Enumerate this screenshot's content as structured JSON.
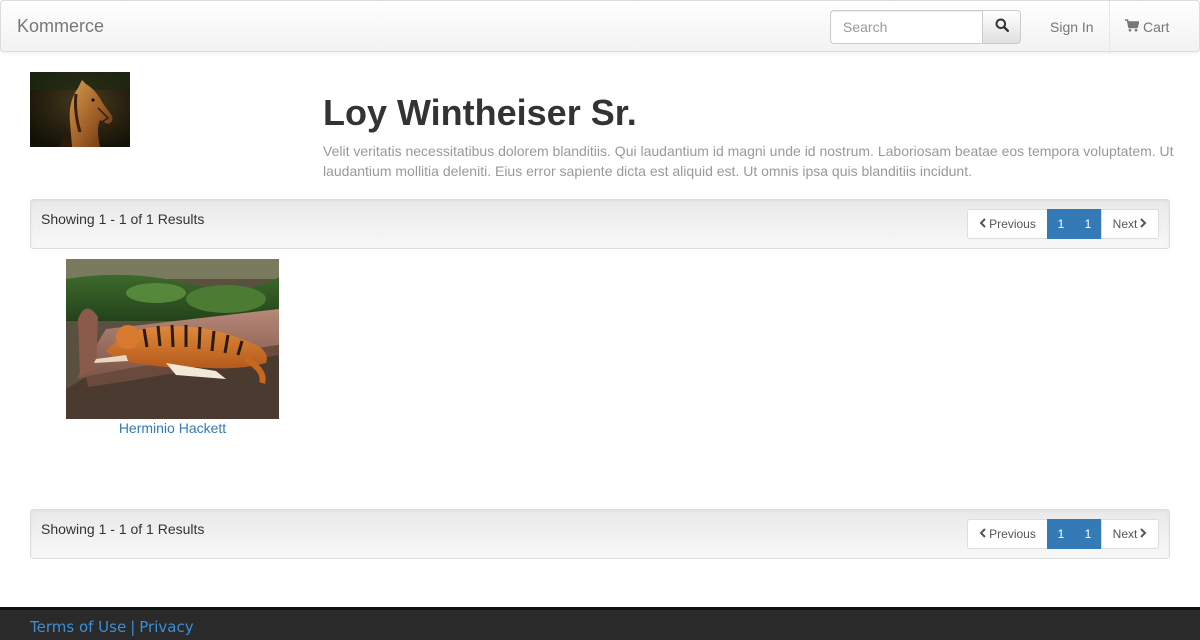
{
  "navbar": {
    "brand": "Kommerce",
    "search": {
      "placeholder": "Search",
      "value": ""
    },
    "search_icon": "search-icon",
    "sign_in": "Sign In",
    "cart": {
      "label": "Cart",
      "icon": "cart-icon"
    }
  },
  "store": {
    "name": "Loy Wintheiser Sr.",
    "description": "Velit veritatis necessitatibus dolorem blanditiis. Qui laudantium id magni unde id nostrum. Laboriosam beatae eos tempora voluptatem. Ut laudantium mollitia deleniti. Eius error sapiente dicta est aliquid est. Ut omnis ipsa quis blanditiis incidunt.",
    "logo_icon": "horse-photo"
  },
  "results": {
    "summary": "Showing 1 - 1 of 1 Results",
    "pagination": {
      "previous": "Previous",
      "pages": [
        "1",
        "1"
      ],
      "next": "Next"
    }
  },
  "products": [
    {
      "name": "Herminio Hackett",
      "image": "tiger-photo"
    }
  ],
  "footer": {
    "terms": "Terms of Use",
    "separator": "|",
    "privacy": "Privacy"
  },
  "colors": {
    "link": "#337ab7",
    "active_page": "#337ab7",
    "footer_bg": "#2a2a2a"
  }
}
